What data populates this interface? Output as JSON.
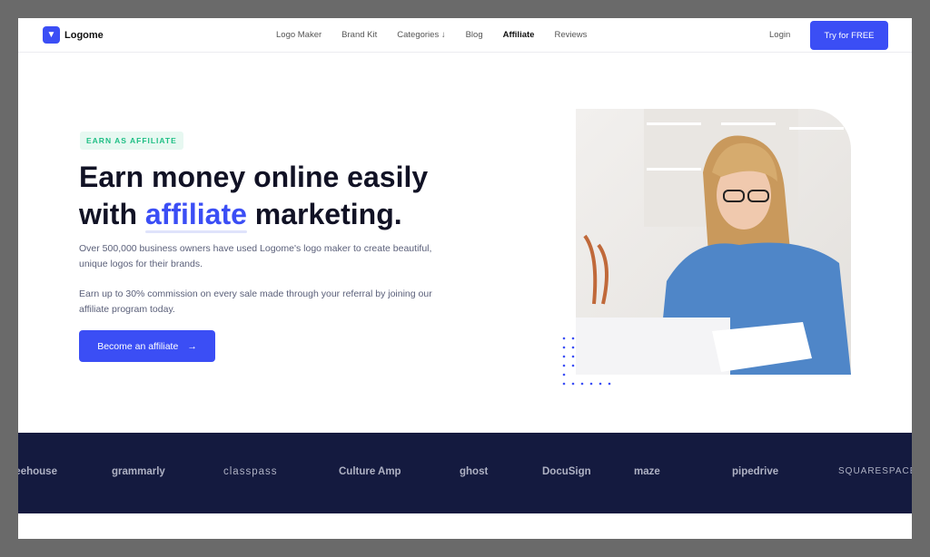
{
  "header": {
    "logo": "Logome",
    "nav": [
      "Logo Maker",
      "Brand Kit",
      "Categories ↓",
      "Blog",
      "Affiliate",
      "Reviews"
    ],
    "active": "Affiliate",
    "login": "Login",
    "cta": "Try for FREE"
  },
  "hero": {
    "badge": "EARN AS AFFILIATE",
    "title_1": "Earn money online easily",
    "title_2a": "with ",
    "title_hl": "affiliate",
    "title_2b": " marketing.",
    "para1": "Over 500,000 business owners have used Logome's logo maker to create beautiful, unique logos for their brands.",
    "para2": "Earn up to 30% commission on every sale made through your referral by joining our affiliate program today.",
    "cta": "Become an affiliate",
    "cta_icon": "→"
  },
  "brands": [
    "treehouse",
    "grammarly",
    "classpass",
    "Culture Amp",
    "ghost",
    "DocuSign",
    "maze",
    "pipedrive",
    "SQUARESPACE"
  ],
  "colors": {
    "accent": "#3b4ef5",
    "band": "#141a3f",
    "badge": "#1fbf85"
  }
}
